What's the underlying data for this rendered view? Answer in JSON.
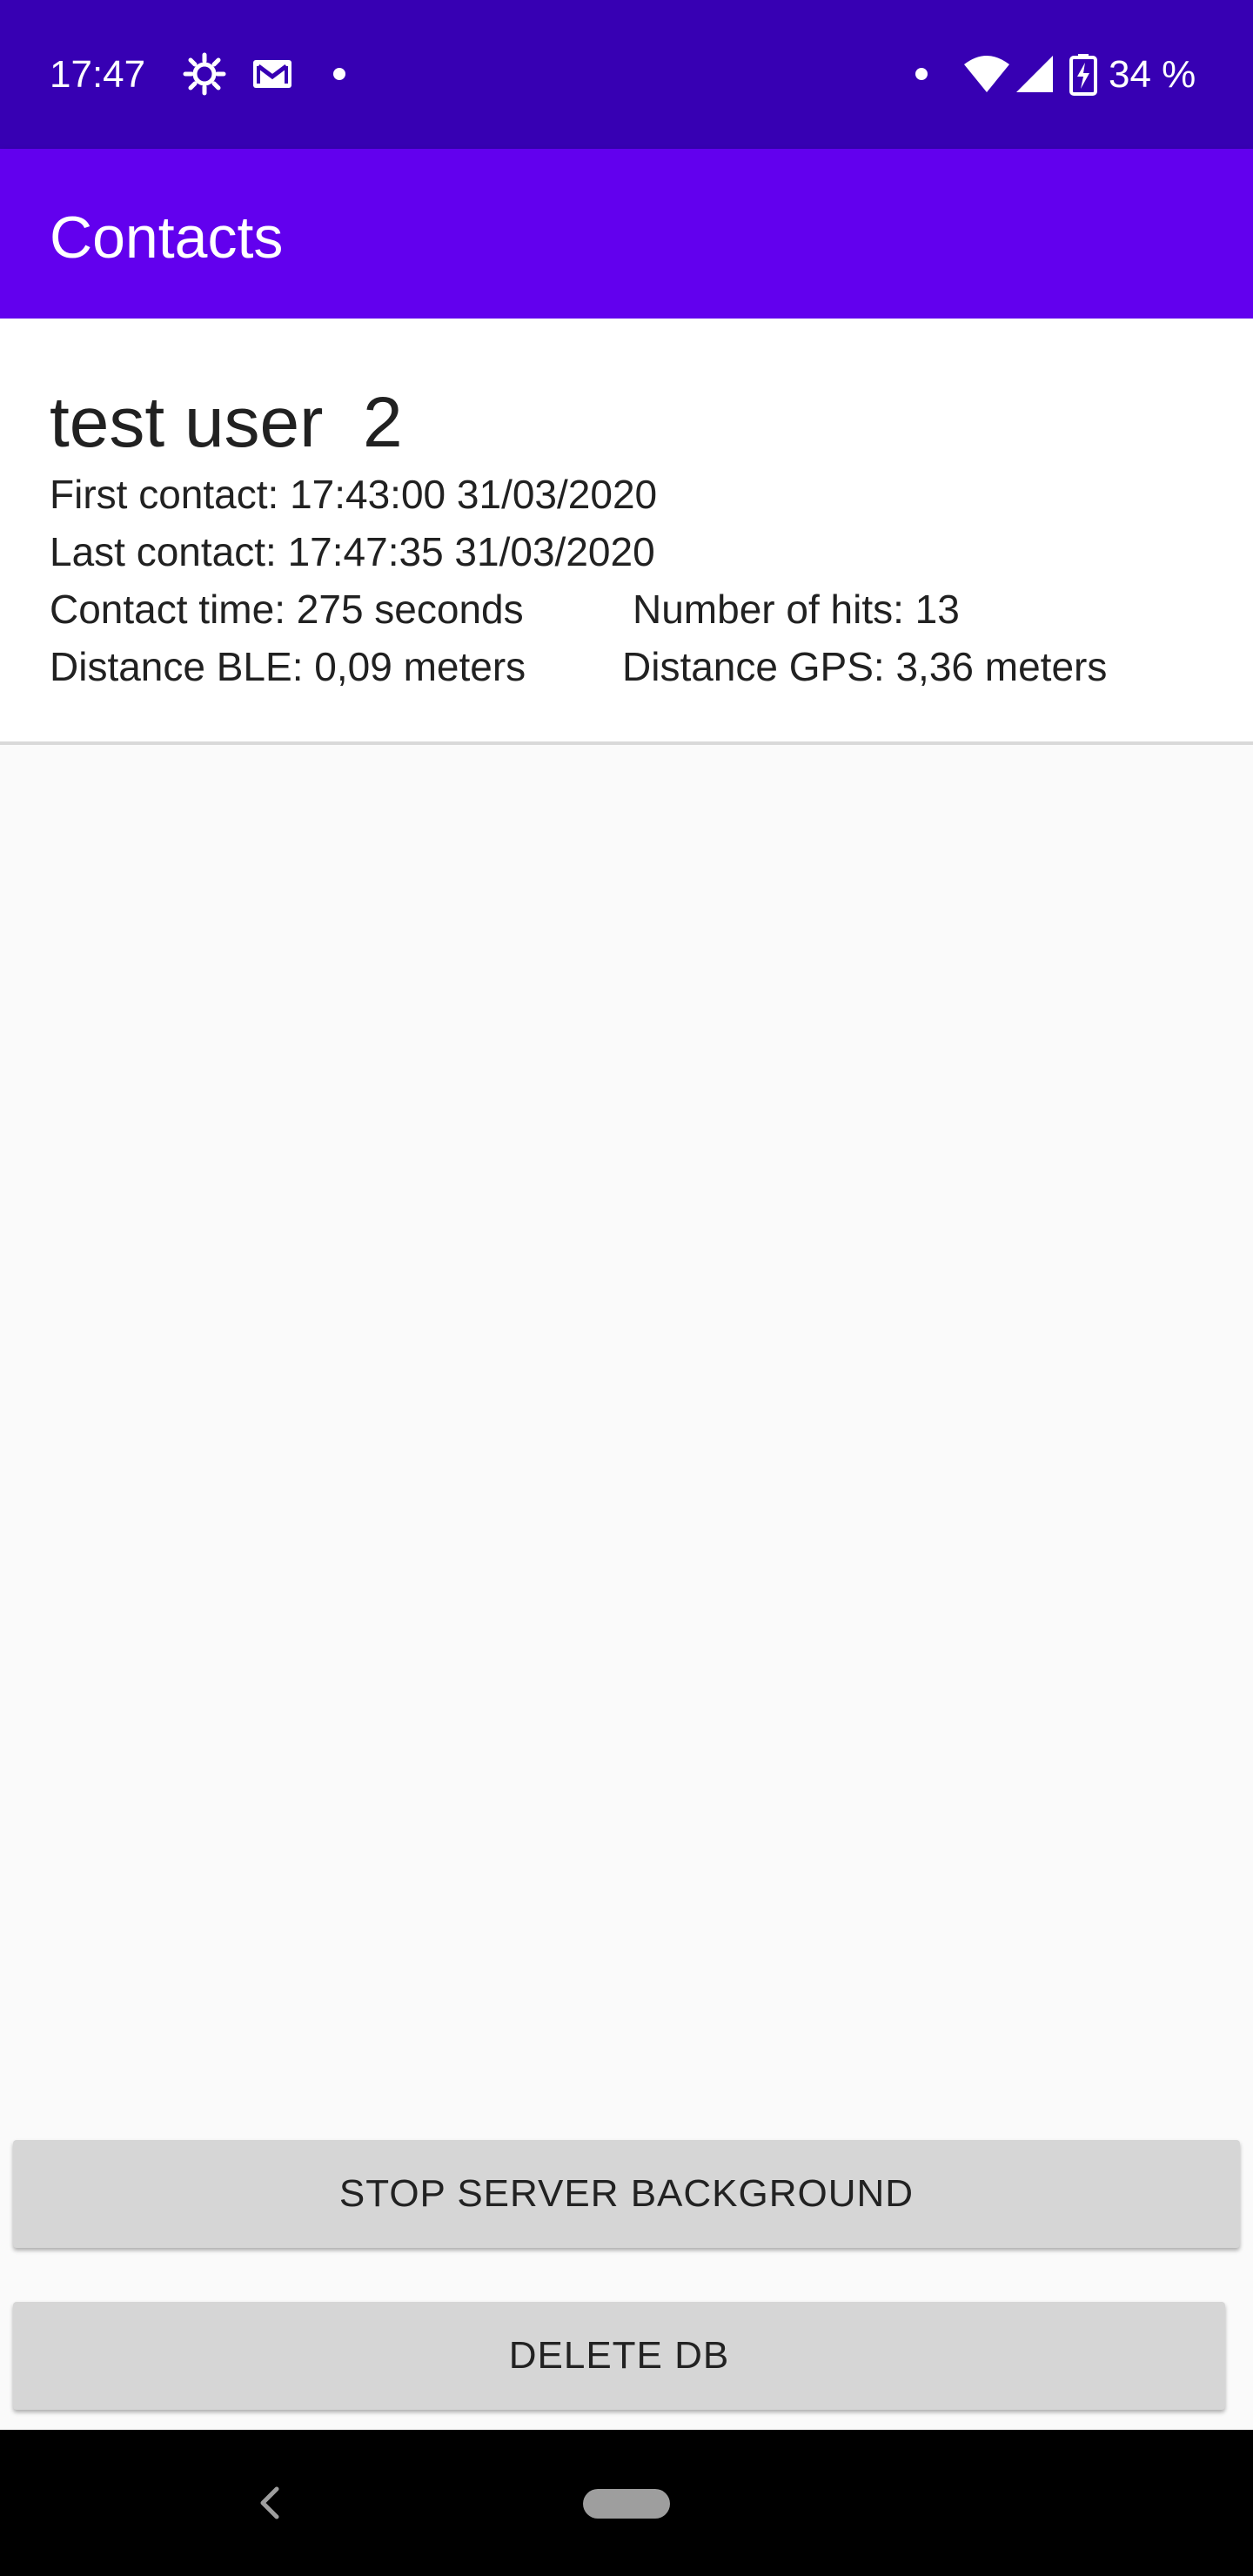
{
  "status_bar": {
    "time": "17:47",
    "battery_percent": "34 %",
    "icons": [
      "settings-gear-icon",
      "gmail-icon",
      "notification-dot-icon",
      "dot-icon",
      "wifi-icon",
      "cell-signal-icon",
      "battery-charging-icon"
    ]
  },
  "app_bar": {
    "title": "Contacts"
  },
  "contact": {
    "name": "test user  2",
    "first_contact": "First contact: 17:43:00 31/03/2020",
    "last_contact": "Last contact: 17:47:35 31/03/2020",
    "contact_time": "Contact time: 275 seconds",
    "number_of_hits": "Number of hits: 13",
    "distance_ble": "Distance BLE: 0,09 meters",
    "distance_gps": "Distance GPS: 3,36 meters"
  },
  "buttons": {
    "stop_server": "STOP SERVER BACKGROUND",
    "delete_db": "DELETE DB"
  },
  "colors": {
    "status_bar": "#3700b3",
    "app_bar": "#6200ee",
    "button_bg": "#d6d6d6"
  }
}
